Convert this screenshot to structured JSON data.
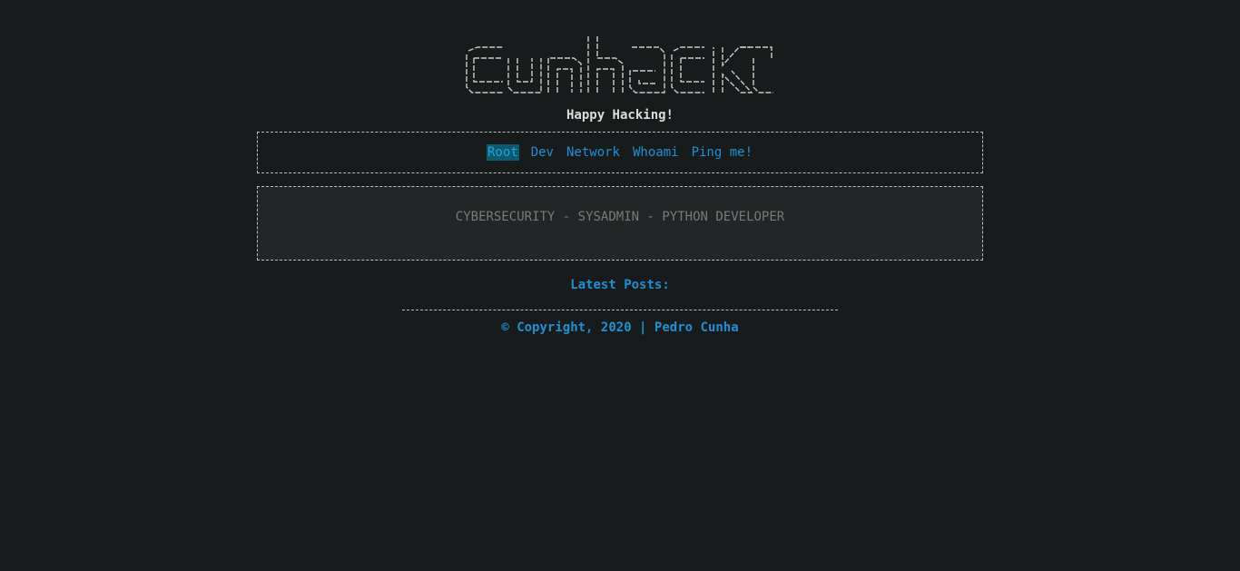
{
  "header": {
    "logo_text": "cunhack",
    "tagline": "Happy Hacking!"
  },
  "nav": {
    "items": [
      {
        "label": "Root",
        "active": true
      },
      {
        "label": "Dev",
        "active": false
      },
      {
        "label": "Network",
        "active": false
      },
      {
        "label": "Whoami",
        "active": false
      },
      {
        "label": "Ping me!",
        "active": false
      }
    ]
  },
  "intro": {
    "text": "CYBERSECURITY - SYSADMIN - PYTHON DEVELOPER"
  },
  "posts": {
    "heading": "Latest Posts:"
  },
  "footer": {
    "text": "© Copyright, 2020 | Pedro Cunha"
  },
  "colors": {
    "background": "#181b1c",
    "link": "#1d8fd4",
    "active_highlight": "#0b5a6e",
    "box_background": "#222627",
    "muted_text": "#7a7a7a"
  }
}
